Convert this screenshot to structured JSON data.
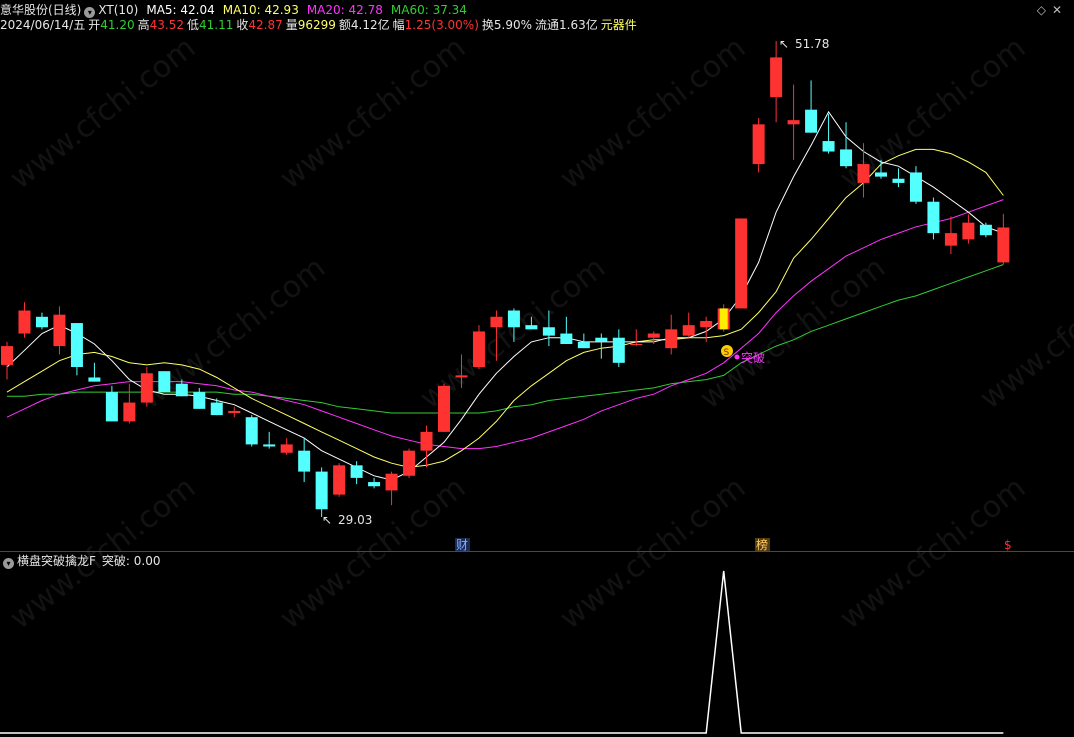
{
  "header": {
    "stock": "意华股份(日线)",
    "indicator": "XT(10)",
    "ma5": "MA5: 42.04",
    "ma10": "MA10: 42.93",
    "ma20": "MA20: 42.78",
    "ma60": "MA60: 37.34",
    "date": "2024/06/14/五",
    "open_label": "开",
    "open": "41.20",
    "high_label": "高",
    "high": "43.52",
    "low_label": "低",
    "low": "41.11",
    "close_label": "收",
    "close": "42.87",
    "vol_label": "量",
    "vol": "96299",
    "amount": "额4.12亿",
    "chg_label": "幅",
    "chg": "1.25(3.00%)",
    "turnover": "换5.90%",
    "float": "流通1.63亿",
    "sector": "元器件"
  },
  "subheader": {
    "title": "横盘突破擒龙F",
    "value": "突破: 0.00"
  },
  "markers": {
    "high": "51.78",
    "low": "29.03",
    "signal": "突破",
    "cai": "财",
    "bang": "榜",
    "dollar": "$"
  },
  "watermark": "www.cfchi.com",
  "colors": {
    "up": "#ff3232",
    "down": "#54ffff",
    "ma5": "#ffffff",
    "ma10": "#ffff66",
    "ma20": "#ff33ff",
    "ma60": "#33cc33",
    "signal_bar": "#ffee00"
  },
  "chart_data": [
    {
      "type": "candlestick",
      "price_range": [
        29.03,
        51.78
      ],
      "candles": [
        {
          "o": 36.3,
          "h": 37.4,
          "l": 35.6,
          "c": 37.2
        },
        {
          "o": 37.8,
          "h": 39.3,
          "l": 37.6,
          "c": 38.9
        },
        {
          "o": 38.6,
          "h": 38.8,
          "l": 38.0,
          "c": 38.1
        },
        {
          "o": 37.2,
          "h": 39.1,
          "l": 36.8,
          "c": 38.7
        },
        {
          "o": 38.3,
          "h": 38.3,
          "l": 35.8,
          "c": 36.2
        },
        {
          "o": 35.7,
          "h": 36.4,
          "l": 35.5,
          "c": 35.5
        },
        {
          "o": 35.0,
          "h": 35.3,
          "l": 33.6,
          "c": 33.6
        },
        {
          "o": 33.6,
          "h": 35.4,
          "l": 33.5,
          "c": 34.5
        },
        {
          "o": 34.5,
          "h": 36.2,
          "l": 34.3,
          "c": 35.9
        },
        {
          "o": 36.0,
          "h": 36.0,
          "l": 35.0,
          "c": 35.0
        },
        {
          "o": 35.4,
          "h": 35.6,
          "l": 34.8,
          "c": 34.8
        },
        {
          "o": 35.0,
          "h": 35.2,
          "l": 34.2,
          "c": 34.2
        },
        {
          "o": 34.5,
          "h": 34.7,
          "l": 33.9,
          "c": 33.9
        },
        {
          "o": 34.0,
          "h": 34.3,
          "l": 33.8,
          "c": 34.1
        },
        {
          "o": 33.8,
          "h": 33.9,
          "l": 32.4,
          "c": 32.5
        },
        {
          "o": 32.5,
          "h": 33.1,
          "l": 32.3,
          "c": 32.4
        },
        {
          "o": 32.1,
          "h": 32.8,
          "l": 32.0,
          "c": 32.5
        },
        {
          "o": 32.2,
          "h": 32.8,
          "l": 30.7,
          "c": 31.2
        },
        {
          "o": 31.2,
          "h": 31.4,
          "l": 29.03,
          "c": 29.4
        },
        {
          "o": 30.1,
          "h": 31.6,
          "l": 30.0,
          "c": 31.5
        },
        {
          "o": 31.5,
          "h": 31.7,
          "l": 30.6,
          "c": 30.9
        },
        {
          "o": 30.7,
          "h": 30.9,
          "l": 30.4,
          "c": 30.5
        },
        {
          "o": 30.3,
          "h": 31.2,
          "l": 29.6,
          "c": 31.1
        },
        {
          "o": 31.0,
          "h": 32.3,
          "l": 30.9,
          "c": 32.2
        },
        {
          "o": 32.2,
          "h": 33.4,
          "l": 31.4,
          "c": 33.1
        },
        {
          "o": 33.1,
          "h": 35.4,
          "l": 33.1,
          "c": 35.3
        },
        {
          "o": 35.7,
          "h": 36.8,
          "l": 35.2,
          "c": 35.8
        },
        {
          "o": 36.2,
          "h": 38.2,
          "l": 36.1,
          "c": 37.9
        },
        {
          "o": 38.1,
          "h": 38.9,
          "l": 36.5,
          "c": 38.6
        },
        {
          "o": 38.9,
          "h": 39.0,
          "l": 37.4,
          "c": 38.1
        },
        {
          "o": 38.2,
          "h": 38.6,
          "l": 38.0,
          "c": 38.0
        },
        {
          "o": 38.1,
          "h": 38.9,
          "l": 37.2,
          "c": 37.7
        },
        {
          "o": 37.8,
          "h": 38.6,
          "l": 37.3,
          "c": 37.3
        },
        {
          "o": 37.4,
          "h": 37.8,
          "l": 37.1,
          "c": 37.1
        },
        {
          "o": 37.6,
          "h": 37.8,
          "l": 36.6,
          "c": 37.4
        },
        {
          "o": 37.6,
          "h": 38.0,
          "l": 36.2,
          "c": 36.4
        },
        {
          "o": 37.3,
          "h": 38.0,
          "l": 37.2,
          "c": 37.3
        },
        {
          "o": 37.6,
          "h": 37.9,
          "l": 37.3,
          "c": 37.8
        },
        {
          "o": 37.1,
          "h": 38.7,
          "l": 36.8,
          "c": 38.0
        },
        {
          "o": 37.7,
          "h": 38.8,
          "l": 37.6,
          "c": 38.2
        },
        {
          "o": 38.1,
          "h": 38.6,
          "l": 37.4,
          "c": 38.4
        },
        {
          "o": 38.0,
          "h": 39.2,
          "l": 37.9,
          "c": 39.0
        },
        {
          "o": 39.0,
          "h": 43.3,
          "l": 39.0,
          "c": 43.3
        },
        {
          "o": 45.9,
          "h": 48.1,
          "l": 45.5,
          "c": 47.8
        },
        {
          "o": 49.1,
          "h": 51.78,
          "l": 47.9,
          "c": 51.0
        },
        {
          "o": 47.8,
          "h": 49.7,
          "l": 46.1,
          "c": 48.0
        },
        {
          "o": 48.5,
          "h": 49.9,
          "l": 47.4,
          "c": 47.4
        },
        {
          "o": 47.0,
          "h": 48.3,
          "l": 46.4,
          "c": 46.5
        },
        {
          "o": 46.6,
          "h": 47.9,
          "l": 45.7,
          "c": 45.8
        },
        {
          "o": 45.0,
          "h": 46.9,
          "l": 44.3,
          "c": 45.9
        },
        {
          "o": 45.5,
          "h": 46.1,
          "l": 45.2,
          "c": 45.3
        },
        {
          "o": 45.2,
          "h": 45.7,
          "l": 44.8,
          "c": 45.0
        },
        {
          "o": 45.5,
          "h": 45.8,
          "l": 44.0,
          "c": 44.1
        },
        {
          "o": 44.1,
          "h": 44.3,
          "l": 42.3,
          "c": 42.6
        },
        {
          "o": 42.0,
          "h": 43.4,
          "l": 41.6,
          "c": 42.6
        },
        {
          "o": 42.3,
          "h": 43.5,
          "l": 42.1,
          "c": 43.1
        },
        {
          "o": 43.0,
          "h": 43.1,
          "l": 42.4,
          "c": 42.5
        },
        {
          "o": 41.2,
          "h": 43.52,
          "l": 41.11,
          "c": 42.87
        }
      ],
      "ma5": [
        36.2,
        37.0,
        37.8,
        38.2,
        37.8,
        37.3,
        36.5,
        35.6,
        35.1,
        34.9,
        34.9,
        34.8,
        34.6,
        34.4,
        34.0,
        33.6,
        33.2,
        32.8,
        32.2,
        31.8,
        31.4,
        31.0,
        30.8,
        31.2,
        31.9,
        32.6,
        33.7,
        34.9,
        35.9,
        36.7,
        37.4,
        37.6,
        37.6,
        37.4,
        37.4,
        37.4,
        37.4,
        37.4,
        37.6,
        37.6,
        37.9,
        38.5,
        39.6,
        41.2,
        43.6,
        45.3,
        46.8,
        48.4,
        47.2,
        46.5,
        46.0,
        45.8,
        45.3,
        44.8,
        44.2,
        43.6,
        42.9,
        42.6
      ],
      "ma10": [
        35.0,
        35.5,
        36.0,
        36.5,
        36.8,
        36.9,
        36.7,
        36.4,
        36.3,
        36.4,
        36.3,
        36.1,
        35.7,
        35.2,
        34.7,
        34.3,
        33.9,
        33.5,
        33.1,
        32.7,
        32.3,
        31.9,
        31.6,
        31.4,
        31.5,
        31.7,
        32.2,
        32.8,
        33.6,
        34.6,
        35.3,
        35.9,
        36.5,
        36.9,
        37.1,
        37.2,
        37.4,
        37.5,
        37.5,
        37.6,
        37.6,
        37.7,
        38.0,
        38.8,
        39.8,
        41.4,
        42.3,
        43.3,
        44.3,
        45.0,
        45.9,
        46.3,
        46.6,
        46.6,
        46.4,
        46.0,
        45.5,
        44.4
      ],
      "ma20": [
        33.8,
        34.2,
        34.6,
        34.9,
        35.1,
        35.3,
        35.4,
        35.5,
        35.5,
        35.5,
        35.5,
        35.4,
        35.3,
        35.1,
        35.0,
        34.8,
        34.6,
        34.4,
        34.1,
        33.8,
        33.5,
        33.2,
        32.9,
        32.7,
        32.5,
        32.4,
        32.3,
        32.3,
        32.4,
        32.6,
        32.8,
        33.1,
        33.4,
        33.7,
        34.1,
        34.4,
        34.7,
        34.9,
        35.3,
        35.6,
        35.9,
        36.4,
        37.1,
        37.8,
        38.8,
        39.6,
        40.3,
        40.9,
        41.5,
        41.9,
        42.3,
        42.6,
        42.9,
        43.1,
        43.3,
        43.6,
        43.9,
        44.2
      ],
      "ma60": [
        34.8,
        34.8,
        34.9,
        34.9,
        35.0,
        35.0,
        35.0,
        35.0,
        35.0,
        35.0,
        35.0,
        35.0,
        35.0,
        34.9,
        34.9,
        34.8,
        34.7,
        34.6,
        34.5,
        34.3,
        34.2,
        34.1,
        34.0,
        34.0,
        34.0,
        34.0,
        34.0,
        34.0,
        34.1,
        34.3,
        34.4,
        34.6,
        34.7,
        34.8,
        34.9,
        35.0,
        35.1,
        35.2,
        35.4,
        35.5,
        35.6,
        35.8,
        36.4,
        36.8,
        37.2,
        37.5,
        37.9,
        38.2,
        38.5,
        38.8,
        39.1,
        39.4,
        39.6,
        39.9,
        40.2,
        40.5,
        40.8,
        41.1
      ]
    },
    {
      "type": "line",
      "name": "突破",
      "values": [
        0,
        0,
        0,
        0,
        0,
        0,
        0,
        0,
        0,
        0,
        0,
        0,
        0,
        0,
        0,
        0,
        0,
        0,
        0,
        0,
        0,
        0,
        0,
        0,
        0,
        0,
        0,
        0,
        0,
        0,
        0,
        0,
        0,
        0,
        0,
        0,
        0,
        0,
        0,
        0,
        0,
        1,
        0,
        0,
        0,
        0,
        0,
        0,
        0,
        0,
        0,
        0,
        0,
        0,
        0,
        0,
        0,
        0
      ],
      "current": 0
    }
  ]
}
